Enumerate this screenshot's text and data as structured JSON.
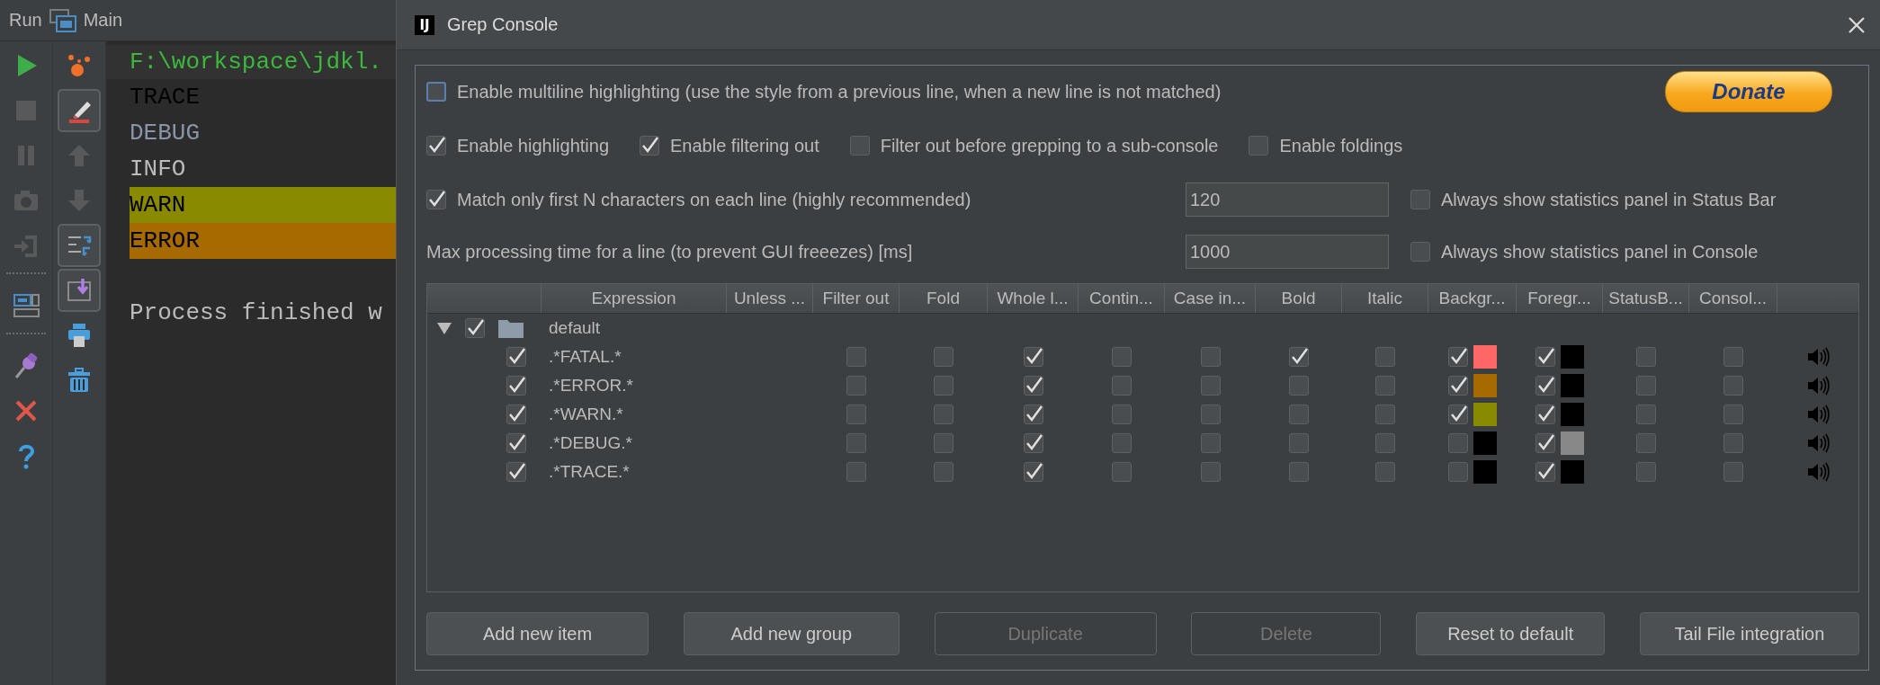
{
  "run_panel": {
    "title": "Run",
    "tab": "Main",
    "toolbar_primary": [
      {
        "kind": "run",
        "disabled": false
      },
      {
        "kind": "stop",
        "disabled": true
      },
      {
        "kind": "pause",
        "disabled": true
      },
      {
        "kind": "camera",
        "disabled": true
      },
      {
        "kind": "exit",
        "disabled": true
      },
      {
        "kind": "separator"
      },
      {
        "kind": "layout",
        "disabled": false
      },
      {
        "kind": "separator"
      },
      {
        "kind": "pin",
        "disabled": false
      },
      {
        "kind": "close",
        "disabled": false
      },
      {
        "kind": "help",
        "disabled": false
      }
    ],
    "toolbar_secondary": [
      {
        "kind": "bubbles",
        "disabled": false,
        "pressed": false
      },
      {
        "kind": "pencil",
        "disabled": false,
        "pressed": true
      },
      {
        "kind": "up",
        "disabled": true,
        "pressed": false
      },
      {
        "kind": "down",
        "disabled": true,
        "pressed": false
      },
      {
        "kind": "swap",
        "disabled": false,
        "pressed": true
      },
      {
        "kind": "import",
        "disabled": false,
        "pressed": true
      },
      {
        "kind": "printer",
        "disabled": false,
        "pressed": false
      },
      {
        "kind": "trash",
        "disabled": false,
        "pressed": false
      }
    ],
    "console_lines": [
      {
        "kind": "command",
        "text": "F:\\workspace\\jdkl."
      },
      {
        "kind": "trace",
        "text": "TRACE"
      },
      {
        "kind": "debug",
        "text": "DEBUG"
      },
      {
        "kind": "info",
        "text": "INFO"
      },
      {
        "kind": "warn",
        "text": "WARN"
      },
      {
        "kind": "error",
        "text": "ERROR"
      },
      {
        "kind": "result",
        "text": "Process finished w"
      }
    ]
  },
  "dialog": {
    "logo": "IJ",
    "title": "Grep Console",
    "option_rows": [
      [
        {
          "kind": "checkbox",
          "label": "Enable multiline highlighting (use the style from a previous line, when a new line is not matched)",
          "checked": false,
          "focused": true
        },
        {
          "kind": "donate",
          "label": "Donate"
        }
      ],
      [
        {
          "kind": "checkbox",
          "label": "Enable highlighting",
          "checked": true
        },
        {
          "kind": "checkbox",
          "label": "Enable filtering out",
          "checked": true
        },
        {
          "kind": "checkbox",
          "label": "Filter out before grepping to a sub-console",
          "checked": false
        },
        {
          "kind": "checkbox",
          "label": "Enable foldings",
          "checked": false
        }
      ],
      [
        {
          "kind": "checkbox",
          "label": "Match only first N characters on each line (highly recommended)",
          "checked": true
        },
        {
          "kind": "field",
          "value": "120"
        },
        {
          "kind": "checkbox",
          "label": "Always show statistics panel in Status Bar",
          "checked": false
        }
      ],
      [
        {
          "kind": "label",
          "label": "Max processing time for a line (to prevent GUI freeezes) [ms]"
        },
        {
          "kind": "field",
          "value": "1000"
        },
        {
          "kind": "checkbox",
          "label": "Always show statistics panel in Console",
          "checked": false
        }
      ]
    ],
    "table": {
      "columns": [
        {
          "label": "Expression"
        },
        {
          "label": "Unless ..."
        },
        {
          "label": "Filter out"
        },
        {
          "label": "Fold"
        },
        {
          "label": "Whole l..."
        },
        {
          "label": "Contin..."
        },
        {
          "label": "Case in..."
        },
        {
          "label": "Bold"
        },
        {
          "label": "Italic"
        },
        {
          "label": "Backgr..."
        },
        {
          "label": "Foregr..."
        },
        {
          "label": "StatusB..."
        },
        {
          "label": "Consol..."
        }
      ],
      "groups": [
        {
          "label": "default",
          "checked": true,
          "expanded": true,
          "children": [
            {
              "expression": ".*FATAL.*",
              "enabled": true,
              "cells": [
                {
                  "kind": "blank"
                },
                {
                  "kind": "check",
                  "checked": false
                },
                {
                  "kind": "check",
                  "checked": false
                },
                {
                  "kind": "check",
                  "checked": true
                },
                {
                  "kind": "check",
                  "checked": false
                },
                {
                  "kind": "check",
                  "checked": false
                },
                {
                  "kind": "check",
                  "checked": true
                },
                {
                  "kind": "check",
                  "checked": false
                },
                {
                  "kind": "color",
                  "checked": true,
                  "color": "#ff6666"
                },
                {
                  "kind": "color",
                  "checked": true,
                  "color": "#000000"
                },
                {
                  "kind": "check",
                  "checked": false
                },
                {
                  "kind": "check",
                  "checked": false
                },
                {
                  "kind": "sound"
                }
              ]
            },
            {
              "expression": ".*ERROR.*",
              "enabled": true,
              "cells": [
                {
                  "kind": "blank"
                },
                {
                  "kind": "check",
                  "checked": false
                },
                {
                  "kind": "check",
                  "checked": false
                },
                {
                  "kind": "check",
                  "checked": true
                },
                {
                  "kind": "check",
                  "checked": false
                },
                {
                  "kind": "check",
                  "checked": false
                },
                {
                  "kind": "check",
                  "checked": false
                },
                {
                  "kind": "check",
                  "checked": false
                },
                {
                  "kind": "color",
                  "checked": true,
                  "color": "#a66a00"
                },
                {
                  "kind": "color",
                  "checked": true,
                  "color": "#000000"
                },
                {
                  "kind": "check",
                  "checked": false
                },
                {
                  "kind": "check",
                  "checked": false
                },
                {
                  "kind": "sound"
                }
              ]
            },
            {
              "expression": ".*WARN.*",
              "enabled": true,
              "cells": [
                {
                  "kind": "blank"
                },
                {
                  "kind": "check",
                  "checked": false
                },
                {
                  "kind": "check",
                  "checked": false
                },
                {
                  "kind": "check",
                  "checked": true
                },
                {
                  "kind": "check",
                  "checked": false
                },
                {
                  "kind": "check",
                  "checked": false
                },
                {
                  "kind": "check",
                  "checked": false
                },
                {
                  "kind": "check",
                  "checked": false
                },
                {
                  "kind": "color",
                  "checked": true,
                  "color": "#8a8a00"
                },
                {
                  "kind": "color",
                  "checked": true,
                  "color": "#000000"
                },
                {
                  "kind": "check",
                  "checked": false
                },
                {
                  "kind": "check",
                  "checked": false
                },
                {
                  "kind": "sound"
                }
              ]
            },
            {
              "expression": ".*DEBUG.*",
              "enabled": true,
              "cells": [
                {
                  "kind": "blank"
                },
                {
                  "kind": "check",
                  "checked": false
                },
                {
                  "kind": "check",
                  "checked": false
                },
                {
                  "kind": "check",
                  "checked": true
                },
                {
                  "kind": "check",
                  "checked": false
                },
                {
                  "kind": "check",
                  "checked": false
                },
                {
                  "kind": "check",
                  "checked": false
                },
                {
                  "kind": "check",
                  "checked": false
                },
                {
                  "kind": "color",
                  "checked": false,
                  "color": "#000000"
                },
                {
                  "kind": "color",
                  "checked": true,
                  "color": "#888888"
                },
                {
                  "kind": "check",
                  "checked": false
                },
                {
                  "kind": "check",
                  "checked": false
                },
                {
                  "kind": "sound"
                }
              ]
            },
            {
              "expression": ".*TRACE.*",
              "enabled": true,
              "cells": [
                {
                  "kind": "blank"
                },
                {
                  "kind": "check",
                  "checked": false
                },
                {
                  "kind": "check",
                  "checked": false
                },
                {
                  "kind": "check",
                  "checked": true
                },
                {
                  "kind": "check",
                  "checked": false
                },
                {
                  "kind": "check",
                  "checked": false
                },
                {
                  "kind": "check",
                  "checked": false
                },
                {
                  "kind": "check",
                  "checked": false
                },
                {
                  "kind": "color",
                  "checked": false,
                  "color": "#000000"
                },
                {
                  "kind": "color",
                  "checked": true,
                  "color": "#000000"
                },
                {
                  "kind": "check",
                  "checked": false
                },
                {
                  "kind": "check",
                  "checked": false
                },
                {
                  "kind": "sound"
                }
              ]
            }
          ]
        }
      ]
    },
    "buttons": [
      {
        "label": "Add new item",
        "disabled": false
      },
      {
        "label": "Add new group",
        "disabled": false
      },
      {
        "label": "Duplicate",
        "disabled": true
      },
      {
        "label": "Delete",
        "disabled": true
      },
      {
        "label": "Reset to default",
        "disabled": false
      },
      {
        "label": "Tail File integration",
        "disabled": false
      }
    ]
  }
}
